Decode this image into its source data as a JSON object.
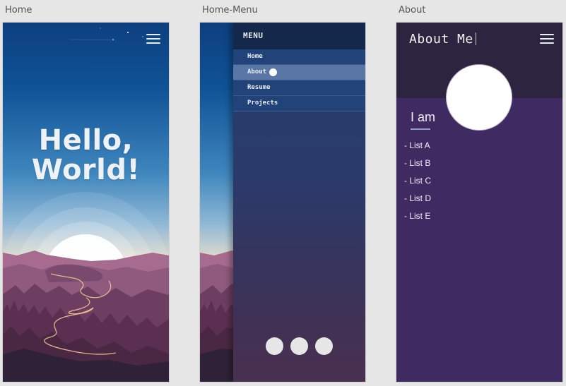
{
  "artboards": {
    "home": {
      "label": "Home",
      "heading_line1": "Hello,",
      "heading_line2": "World!"
    },
    "home_menu": {
      "label": "Home-Menu",
      "menu_title": "MENU",
      "items": [
        "Home",
        "About",
        "Resume",
        "Projects"
      ],
      "active_item": "About"
    },
    "about": {
      "label": "About",
      "title": "About Me",
      "intro": "I am",
      "list": [
        "- List A",
        "- List B",
        "- List C",
        "- List D",
        "- List E"
      ]
    }
  },
  "colors": {
    "canvas_bg": "#e6e6e6",
    "sky_top": "#0e4f93",
    "sky_horizon": "#fbe7cc",
    "mountain_far": "#8f5a7e",
    "forest_dark": "#4a2844",
    "path": "#f0c490",
    "menu_header": "#13284a",
    "menu_item": "#22427a",
    "menu_item_active": "#5a76a6",
    "about_header": "#2d2440",
    "about_body": "#3f2b62",
    "avatar": "#ffffff"
  },
  "icons": [
    "hamburger-icon",
    "pager-dot-icon"
  ]
}
